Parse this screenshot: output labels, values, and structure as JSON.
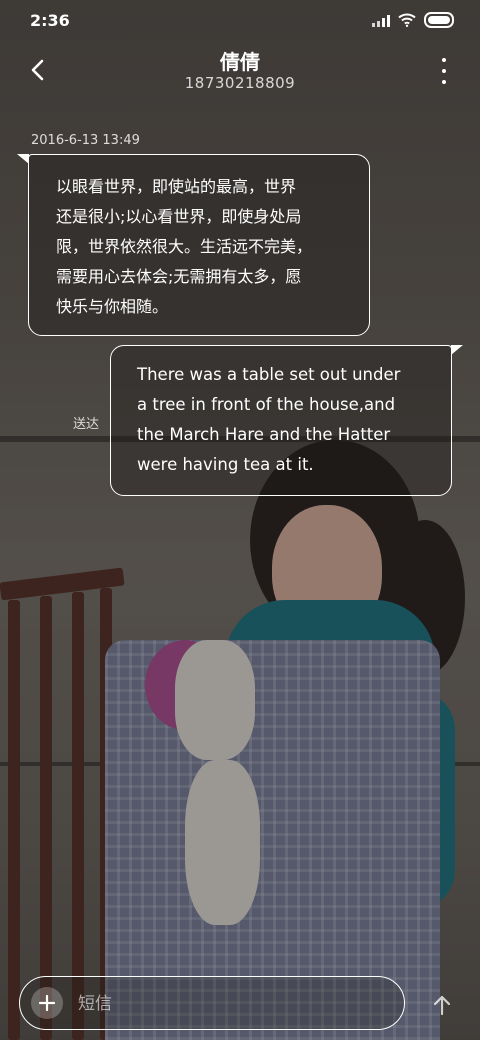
{
  "status_bar": {
    "time": "2:36",
    "icons": [
      "signal-icon",
      "wifi-icon",
      "battery-icon"
    ]
  },
  "header": {
    "back_icon": "chevron-left-icon",
    "contact_name": "倩倩",
    "contact_number": "18730218809",
    "more_icon": "more-vertical-icon"
  },
  "conversation": {
    "timestamp": "2016-6-13 13:49",
    "incoming": {
      "text": "以眼看世界，即使站的最高，世界\n还是很小;以心看世界，即使身处局\n限，世界依然很大。生活远不完美，\n需要用心去体会;无需拥有太多，愿\n快乐与你相随。"
    },
    "outgoing": {
      "text": "There was a table set out under\na tree in front of the house,and\nthe March Hare and the Hatter\nwere having tea at it.",
      "status": "送达"
    }
  },
  "composer": {
    "add_icon": "plus-icon",
    "placeholder": "短信",
    "value": "",
    "send_icon": "arrow-up-icon"
  },
  "colors": {
    "bubble_border": "#ffffff",
    "text": "#ffffff"
  }
}
